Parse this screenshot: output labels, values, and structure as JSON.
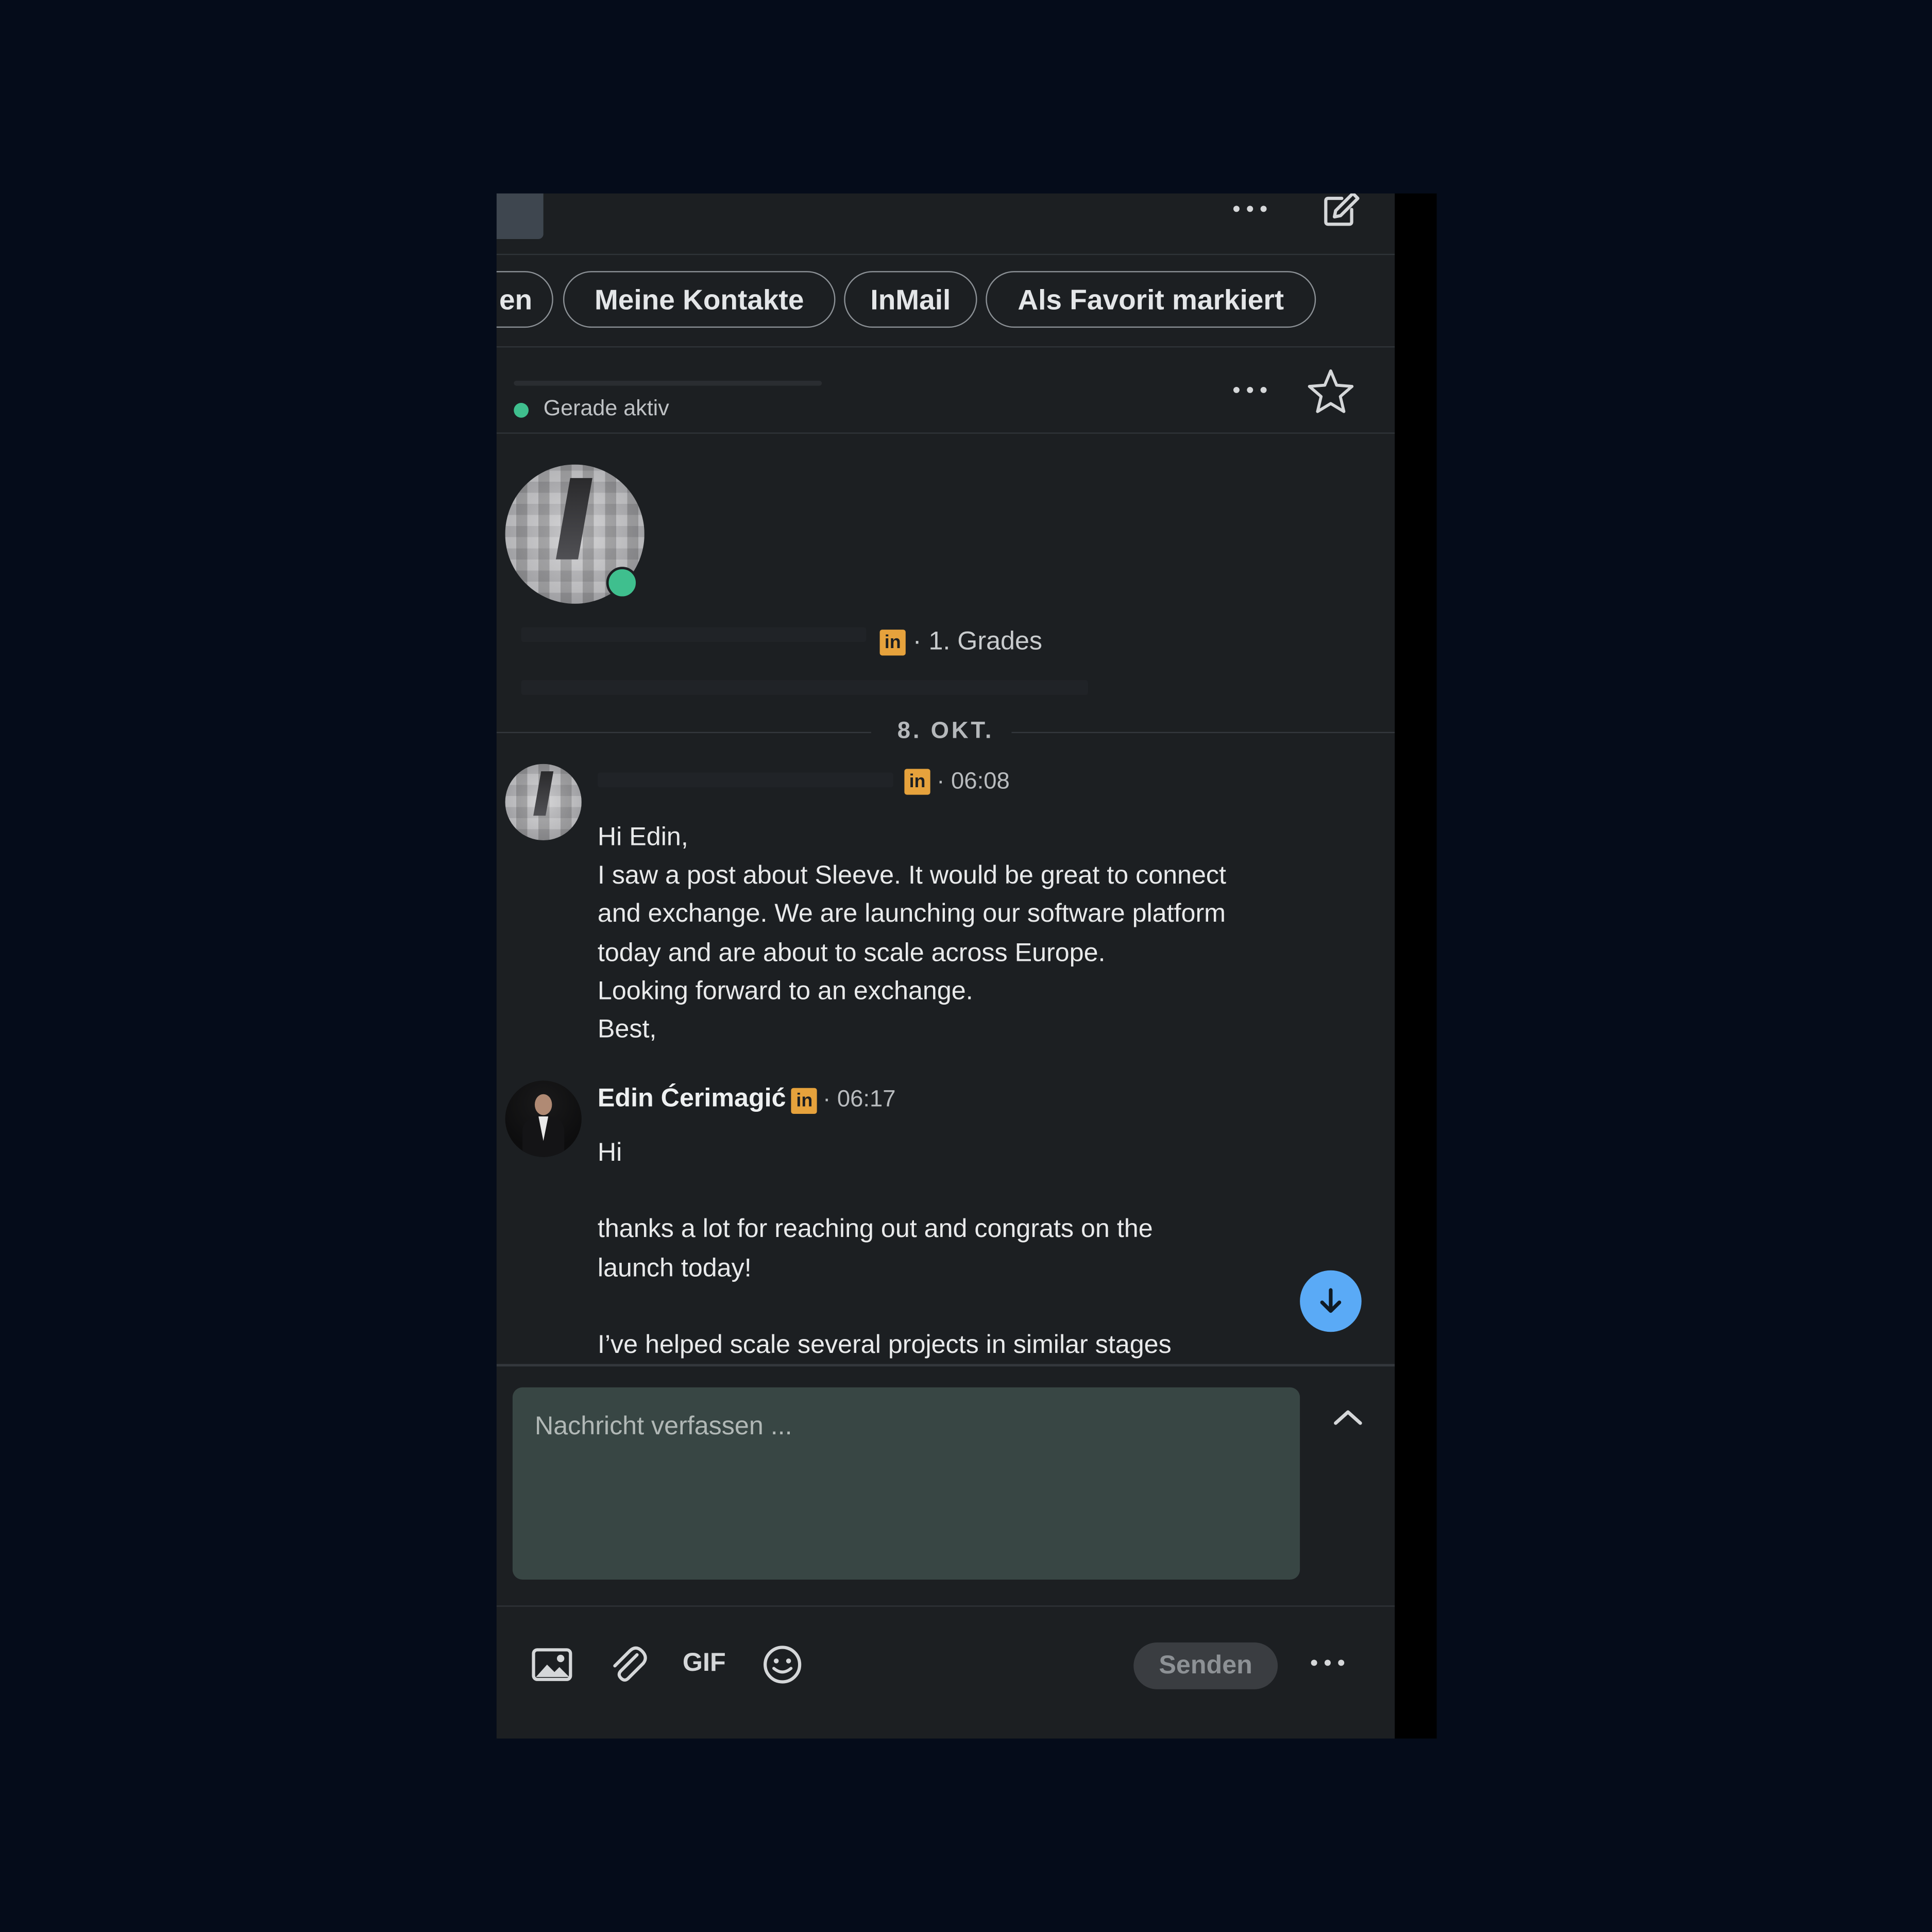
{
  "filters": {
    "chips": [
      "en",
      "Meine Kontakte",
      "InMail",
      "Als Favorit markiert"
    ]
  },
  "conversation_header": {
    "status": "Gerade aktiv"
  },
  "profile": {
    "meta": "· 1. Grades"
  },
  "thread": {
    "date_label": "8. OKT.",
    "messages": [
      {
        "time": "· 06:08",
        "body": "Hi Edin,\nI saw a post about Sleeve. It would be great to connect\nand exchange. We are launching our software platform\ntoday and are about to scale across Europe.\nLooking forward to an exchange.\nBest,"
      },
      {
        "sender": "Edin Ćerimagić",
        "time": "· 06:17",
        "body": "Hi\n\nthanks a lot for reaching out and congrats on the\nlaunch today!\n\nI’ve helped scale several projects in similar stages"
      }
    ]
  },
  "composer": {
    "placeholder": "Nachricht verfassen ...",
    "gif_label": "GIF",
    "send_label": "Senden"
  },
  "badge": {
    "linkedin_text": "in"
  },
  "colors": {
    "background": "#050c1a",
    "panel": "#1c1f22",
    "online": "#3fbf8e",
    "linkedin_badge": "#e6a23c",
    "scroll_button": "#5aaaf6",
    "textbox": "#384644"
  }
}
